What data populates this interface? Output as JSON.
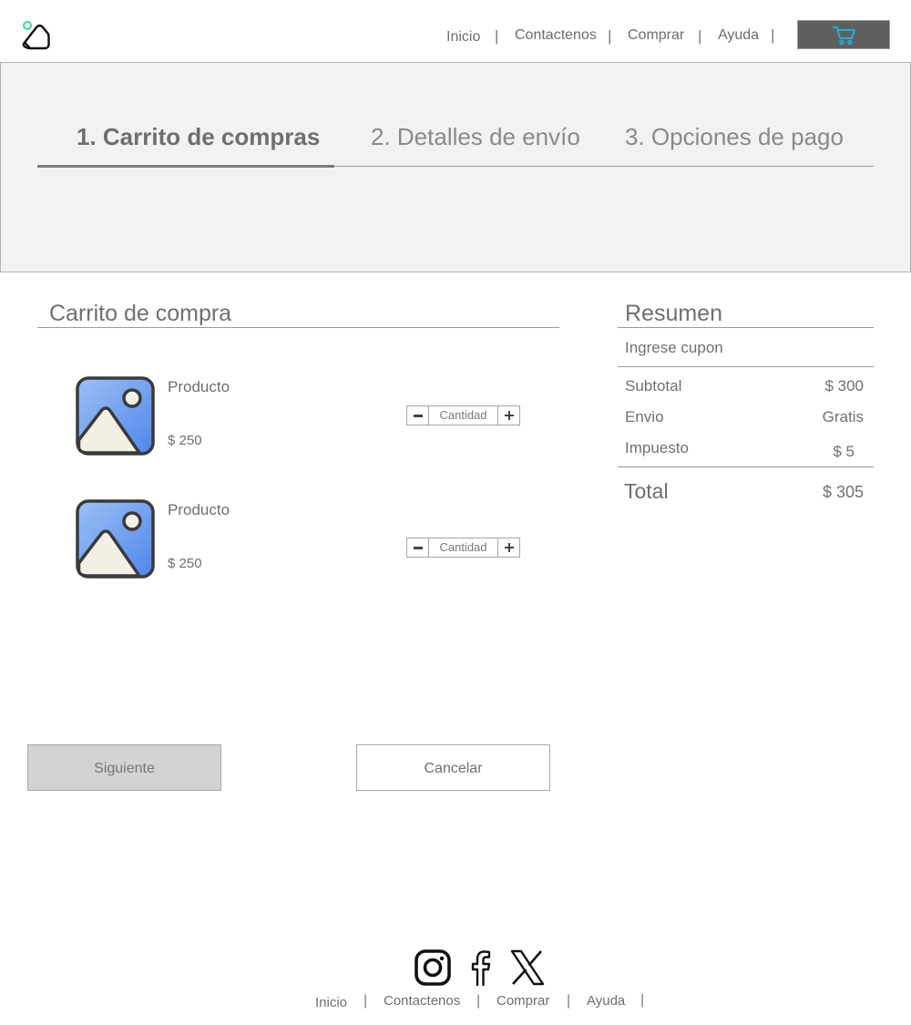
{
  "nav": {
    "items": [
      {
        "label": "Inicio"
      },
      {
        "label": "Contactenos"
      },
      {
        "label": "Comprar"
      },
      {
        "label": "Ayuda"
      }
    ],
    "separator": "|",
    "cart_icon": "shopping-cart-icon"
  },
  "logo": {
    "icon": "app-logo-icon"
  },
  "steps": [
    {
      "label": "1. Carrito de compras",
      "active": true
    },
    {
      "label": "2. Detalles de envío",
      "active": false
    },
    {
      "label": "3. Opciones de pago",
      "active": false
    }
  ],
  "cart": {
    "title": "Carrito de compra",
    "products": [
      {
        "name": "Producto",
        "price": "$ 250",
        "quantity_placeholder": "Cantidad",
        "image_icon": "image-placeholder-icon"
      },
      {
        "name": "Producto",
        "price": "$ 250",
        "quantity_placeholder": "Cantidad",
        "image_icon": "image-placeholder-icon"
      }
    ]
  },
  "summary": {
    "title": "Resumen",
    "coupon_placeholder": "Ingrese cupon",
    "rows": [
      {
        "label": "Subtotal",
        "value": "$ 300"
      },
      {
        "label": "Envio",
        "value": "Gratis"
      },
      {
        "label": "Impuesto",
        "value": "$ 5"
      }
    ],
    "total_label": "Total",
    "total_value": "$ 305"
  },
  "actions": {
    "next_label": "Siguiente",
    "cancel_label": "Cancelar"
  },
  "footer": {
    "social": [
      "instagram-icon",
      "facebook-icon",
      "x-icon"
    ],
    "nav": [
      {
        "label": "Inicio"
      },
      {
        "label": "Contactenos"
      },
      {
        "label": "Comprar"
      },
      {
        "label": "Ayuda"
      }
    ],
    "separator": "|"
  },
  "colors": {
    "accent_green": "#3ddc97",
    "cart_icon": "#29a8d8",
    "image_blue": "#5b8fe8",
    "cart_button_bg": "#5f5f5f"
  }
}
